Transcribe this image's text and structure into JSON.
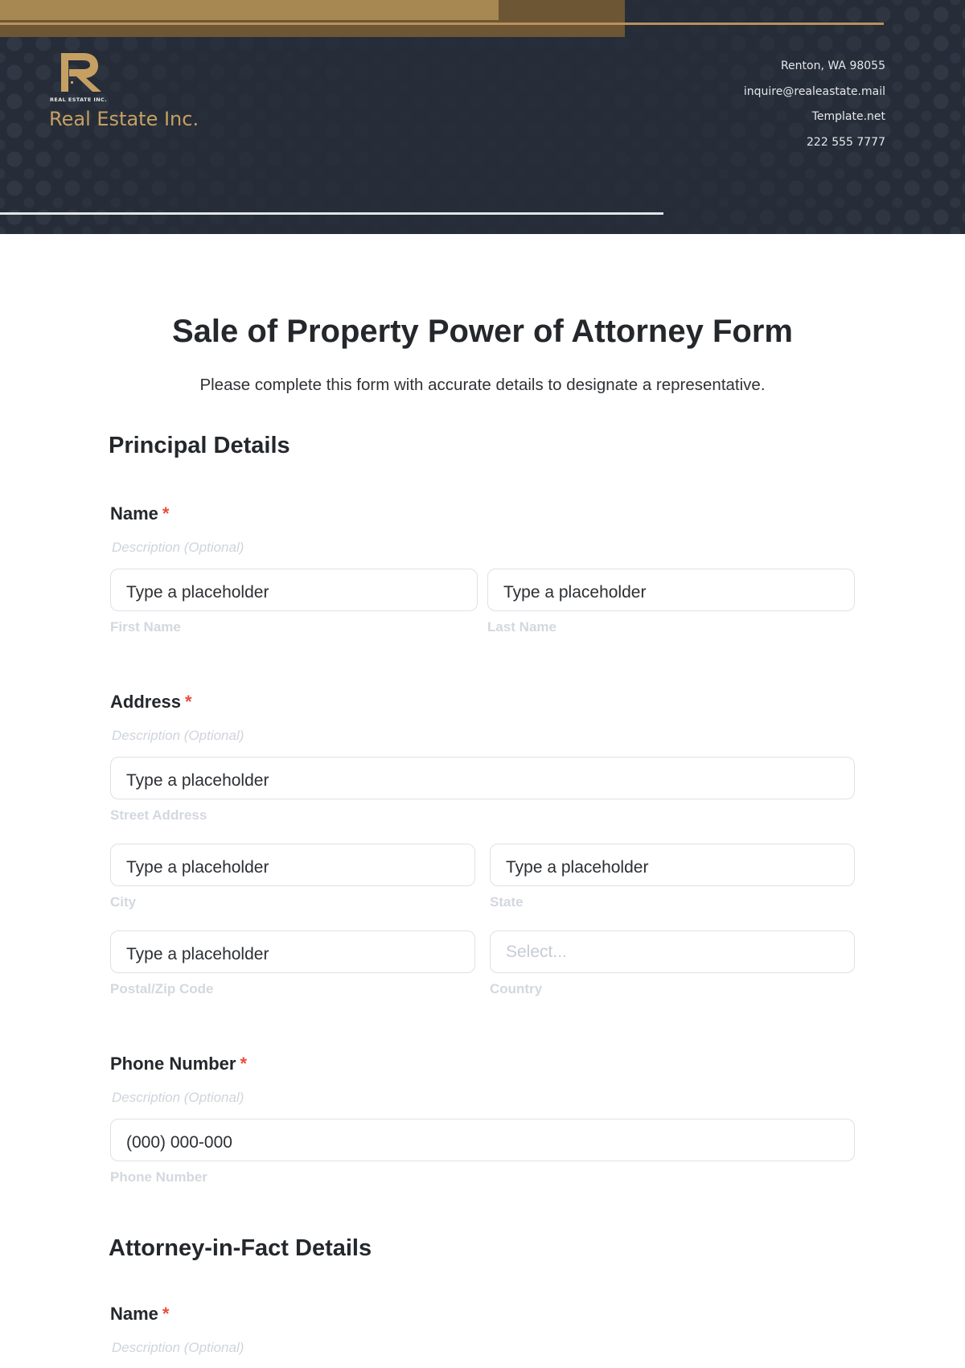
{
  "header": {
    "logo_small_text": "REAL ESTATE INC.",
    "company_name": "Real Estate Inc.",
    "contact": {
      "address": "Renton, WA 98055",
      "email": "inquire@realeastate.mail",
      "website": "Template.net",
      "phone": "222 555 7777"
    },
    "colors": {
      "background": "#262d38",
      "gold": "#c6a063",
      "gold_dark": "#6d5634"
    }
  },
  "form": {
    "title": "Sale of Property Power of Attorney Form",
    "subtitle": "Please complete this form with accurate details to designate a representative.",
    "required_marker": "*",
    "sections": [
      {
        "title": "Principal Details",
        "fields": {
          "name": {
            "label": "Name",
            "description": "Description (Optional)",
            "first": {
              "placeholder": "Type a placeholder",
              "sublabel": "First Name"
            },
            "last": {
              "placeholder": "Type a placeholder",
              "sublabel": "Last Name"
            }
          },
          "address": {
            "label": "Address",
            "description": "Description (Optional)",
            "street": {
              "placeholder": "Type a placeholder",
              "sublabel": "Street Address"
            },
            "city": {
              "placeholder": "Type a placeholder",
              "sublabel": "City"
            },
            "state": {
              "placeholder": "Type a placeholder",
              "sublabel": "State"
            },
            "postal": {
              "placeholder": "Type a placeholder",
              "sublabel": "Postal/Zip Code"
            },
            "country": {
              "placeholder": "Select...",
              "sublabel": "Country"
            }
          },
          "phone": {
            "label": "Phone Number",
            "description": "Description (Optional)",
            "input": {
              "placeholder": "(000) 000-000",
              "sublabel": "Phone Number"
            }
          }
        }
      },
      {
        "title": "Attorney-in-Fact Details",
        "fields": {
          "name": {
            "label": "Name",
            "description": "Description (Optional)"
          }
        }
      }
    ],
    "colors": {
      "required": "#ea4e3d",
      "border": "#dde1e7",
      "muted": "#d3d8df"
    }
  }
}
